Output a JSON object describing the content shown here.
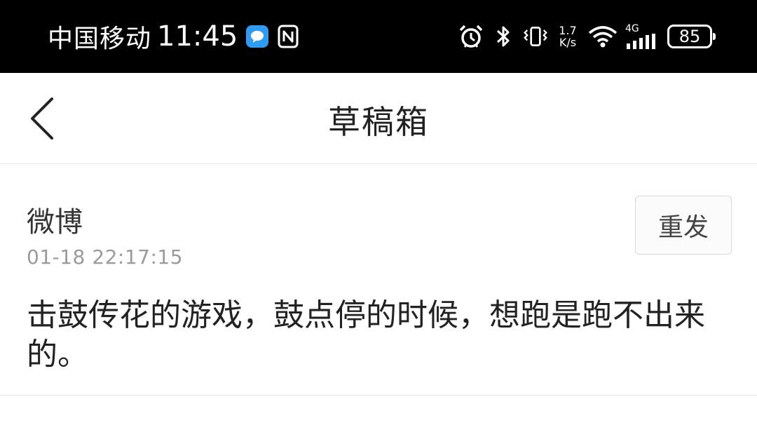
{
  "status_bar": {
    "carrier": "中国移动",
    "time": "11:45",
    "net_speed_value": "1.7",
    "net_speed_unit": "K/s",
    "network_type": "4G",
    "battery_level": "85",
    "icons": [
      "message-icon",
      "nfc-icon",
      "alarm-icon",
      "bluetooth-icon",
      "vibrate-icon",
      "wifi-icon",
      "signal-icon",
      "battery-icon"
    ]
  },
  "nav": {
    "title": "草稿箱"
  },
  "drafts": [
    {
      "source": "微博",
      "time": "01-18 22:17:15",
      "resend_label": "重发",
      "content": "击鼓传花的游戏，鼓点停的时候，想跑是跑不出来的。"
    }
  ]
}
